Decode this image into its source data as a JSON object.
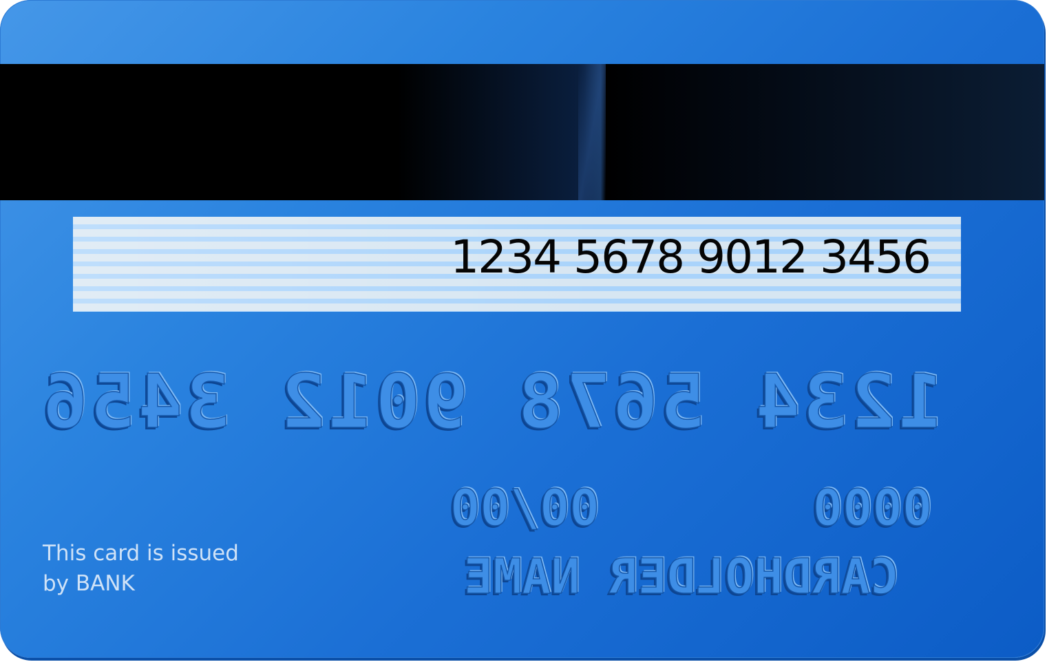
{
  "card": {
    "signature_number": "1234 5678 9012 3456",
    "embossed_number": "1234 5678 9012 3456",
    "embossed_expiry": "00/00",
    "embossed_code": "0000",
    "embossed_name": "CARDHOLDER NAME",
    "issuer_line1": "This card is issued",
    "issuer_line2": "by BANK"
  },
  "colors": {
    "card_blue": "#1b6fd5",
    "stripe": "#000000",
    "panel_light": "#d7e6f2",
    "panel_stripe": "#a9d3fb",
    "issuer_text": "#cfe2f7"
  }
}
